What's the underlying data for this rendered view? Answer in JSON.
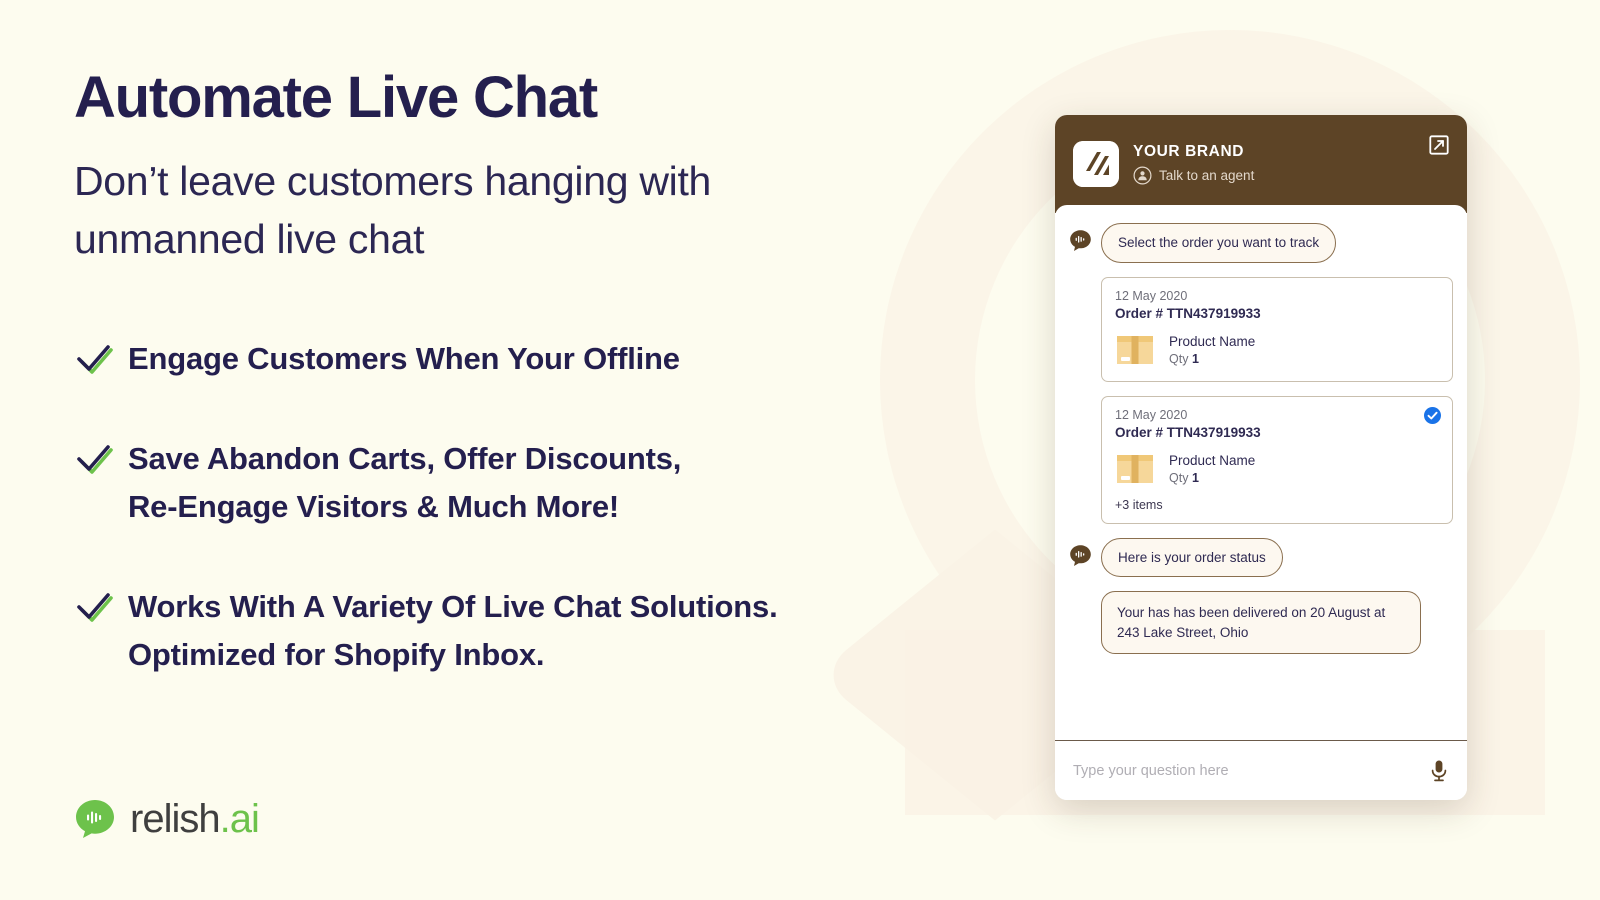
{
  "colors": {
    "page_background": "#fdfcef",
    "deco_shape": "#faf3e6",
    "headline": "#241f4e",
    "brand_brown": "#5d4426",
    "accent_green": "#6dc24b",
    "check_blue": "#1a73e8",
    "box_amber": "#f3d08a"
  },
  "hero": {
    "headline": "Automate Live Chat",
    "subheadline": "Don’t leave customers hanging with unmanned live chat",
    "bullets": [
      {
        "icon": "check-icon",
        "lines": [
          "Engage Customers When Your Offline"
        ]
      },
      {
        "icon": "check-icon",
        "lines": [
          "Save Abandon Carts, Offer Discounts,",
          "Re-Engage Visitors & Much More!"
        ]
      },
      {
        "icon": "check-icon",
        "lines": [
          "Works With A Variety Of Live Chat Solutions.",
          "Optimized for Shopify Inbox."
        ]
      }
    ]
  },
  "logo": {
    "icon": "speech-bubble-waveform-icon",
    "name": "relish",
    "suffix": ".ai"
  },
  "widget": {
    "header": {
      "brand_logo_icon": "brand-slashes-logo",
      "brand_name": "YOUR BRAND",
      "agent_icon": "agent-avatar-icon",
      "agent_label": "Talk to an agent",
      "expand_icon": "expand-arrow-icon"
    },
    "messages": [
      {
        "type": "bot",
        "avatar_icon": "bot-speech-bubble-icon",
        "text": "Select the order you want to track"
      }
    ],
    "orders": [
      {
        "date": "12 May 2020",
        "order_label": "Order #",
        "order_number": "TTN437919933",
        "product_thumb_icon": "package-box-icon",
        "product_name": "Product Name",
        "qty_label": "Qty",
        "qty_value": "1",
        "more_items": "",
        "selected": false
      },
      {
        "date": "12 May 2020",
        "order_label": "Order #",
        "order_number": "TTN437919933",
        "product_thumb_icon": "package-box-icon",
        "product_name": "Product Name",
        "qty_label": "Qty",
        "qty_value": "1",
        "more_items": "+3 items",
        "selected": true
      }
    ],
    "status_messages": [
      {
        "type": "bot",
        "avatar_icon": "bot-speech-bubble-icon",
        "text": "Here is your order status"
      },
      {
        "type": "bot-wide",
        "text": "Your has has been delivered on 20 August at 243 Lake Street, Ohio"
      }
    ],
    "input": {
      "placeholder": "Type your question here",
      "value": "",
      "mic_icon": "microphone-icon"
    }
  }
}
